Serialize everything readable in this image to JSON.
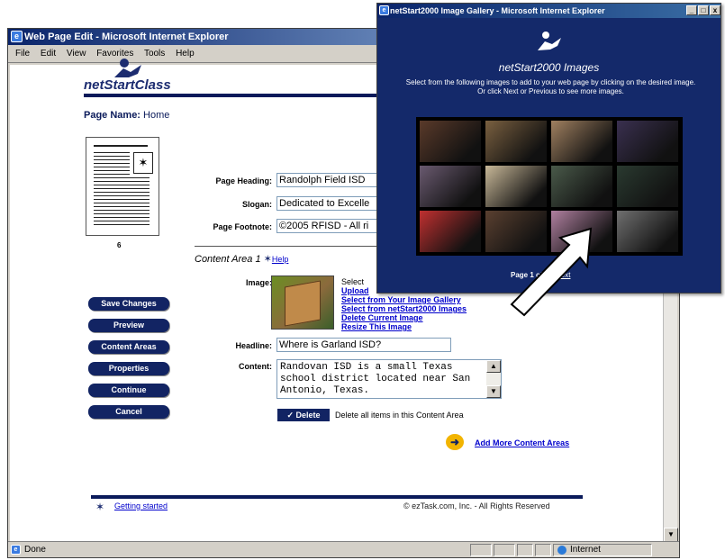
{
  "main_window": {
    "title": "Web Page Edit - Microsoft Internet Explorer",
    "menu": [
      "File",
      "Edit",
      "View",
      "Favorites",
      "Tools",
      "Help"
    ],
    "status_text": "Done",
    "zone": "Internet"
  },
  "page": {
    "logo": "netStartClass",
    "page_name_label": "Page Name:",
    "page_name_value": "Home",
    "thumbnail_number": "6",
    "side_buttons": [
      "Save Changes",
      "Preview",
      "Content Areas",
      "Properties",
      "Continue",
      "Cancel"
    ],
    "fields": {
      "heading_label": "Page Heading:",
      "heading_value": "Randolph Field ISD",
      "slogan_label": "Slogan:",
      "slogan_value": "Dedicated to Excelle",
      "footnote_label": "Page Footnote:",
      "footnote_value": "©2005 RFISD - All ri"
    },
    "content_area_title": "Content Area 1",
    "help_link": "Help",
    "image_label": "Image:",
    "image_links": [
      "Select",
      "Upload",
      "Select from Your Image Gallery",
      "Select from netStart2000 Images",
      "Delete Current Image",
      "Resize This Image"
    ],
    "headline_label": "Headline:",
    "headline_value": "Where is Garland ISD?",
    "content_label": "Content:",
    "content_value": "Randovan ISD is a small Texas\nschool district located near San\nAntonio, Texas.",
    "delete_button": "✓ Delete",
    "delete_desc": "Delete all items in this Content Area",
    "add_more": "Add More Content Areas",
    "getting_started": "Getting started",
    "copyright": "© ezTask.com, Inc. - All Rights Reserved"
  },
  "gallery_window": {
    "title": "netStart2000 Image Gallery - Microsoft Internet Explorer",
    "heading": "netStart2000 Images",
    "instructions": "Select from the following images to add to your web page by clicking on the desired image. Or click Next or Previous to see more images.",
    "page_text": "Page 1 of",
    "next_text": "Next",
    "thumb_colors": [
      "#5a3a2a",
      "#7a6040",
      "#a08060",
      "#3a3050",
      "#6a5a70",
      "#c8b898",
      "#4a5a4a",
      "#2a3a30",
      "#c03030",
      "#5a4030",
      "#b080a0",
      "#707070"
    ]
  },
  "colors": {
    "brand_navy": "#122463",
    "gallery_bg": "#14296a",
    "link": "#0000cc"
  }
}
